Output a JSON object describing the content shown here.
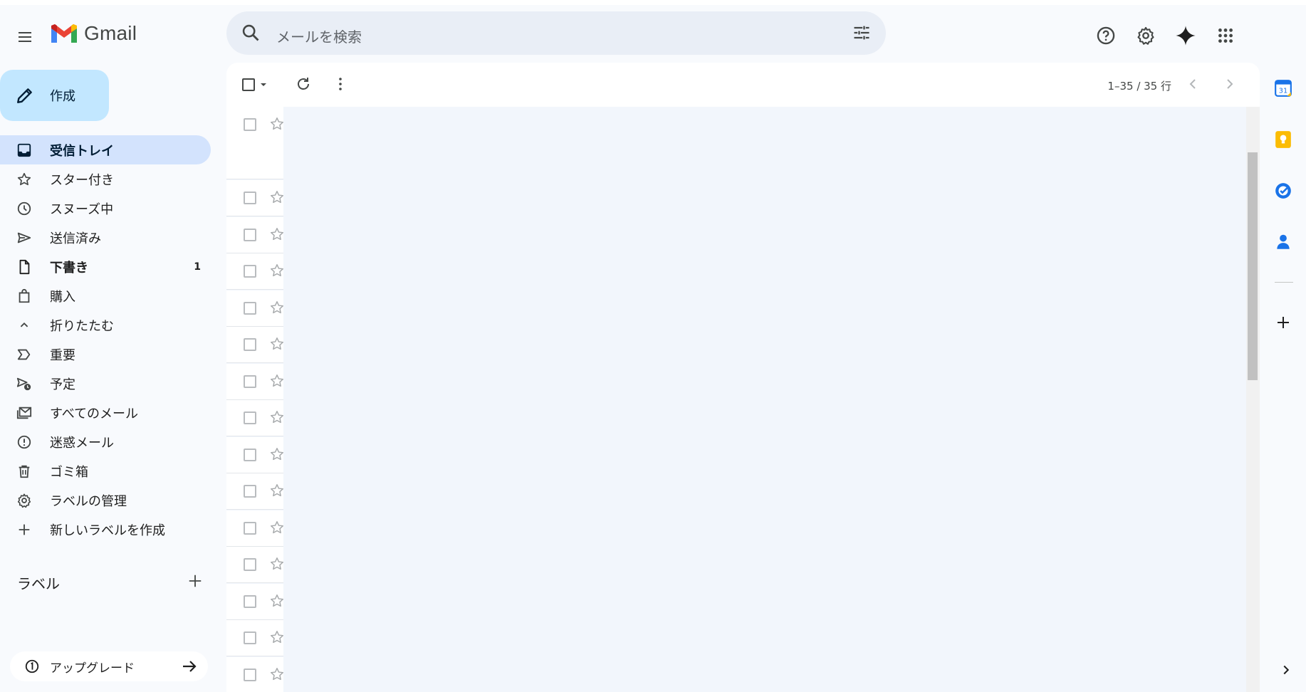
{
  "app": {
    "name": "Gmail"
  },
  "search": {
    "placeholder": "メールを検索"
  },
  "compose": {
    "label": "作成"
  },
  "nav": [
    {
      "label": "受信トレイ",
      "icon": "inbox-icon",
      "active": true,
      "count": ""
    },
    {
      "label": "スター付き",
      "icon": "star-icon",
      "count": ""
    },
    {
      "label": "スヌーズ中",
      "icon": "clock-icon",
      "count": ""
    },
    {
      "label": "送信済み",
      "icon": "send-icon",
      "count": ""
    },
    {
      "label": "下書き",
      "icon": "draft-icon",
      "bold": true,
      "count": "1"
    },
    {
      "label": "購入",
      "icon": "shopping-bag-icon",
      "count": ""
    },
    {
      "label": "折りたたむ",
      "icon": "chevron-up-icon",
      "count": ""
    },
    {
      "label": "重要",
      "icon": "important-icon",
      "count": ""
    },
    {
      "label": "予定",
      "icon": "scheduled-icon",
      "count": ""
    },
    {
      "label": "すべてのメール",
      "icon": "all-mail-icon",
      "count": ""
    },
    {
      "label": "迷惑メール",
      "icon": "spam-icon",
      "count": ""
    },
    {
      "label": "ゴミ箱",
      "icon": "trash-icon",
      "count": ""
    },
    {
      "label": "ラベルの管理",
      "icon": "gear-icon",
      "count": ""
    },
    {
      "label": "新しいラベルを作成",
      "icon": "plus-icon",
      "count": ""
    }
  ],
  "labels": {
    "header": "ラベル"
  },
  "upgrade": {
    "label": "アップグレード"
  },
  "toolbar": {
    "pager": "1–35 / 35 行"
  },
  "colors": {
    "compose": "#c2e7ff",
    "active_nav": "#d3e3fd",
    "search_bg": "#e9eef6",
    "page_bg": "#f8fafd"
  }
}
